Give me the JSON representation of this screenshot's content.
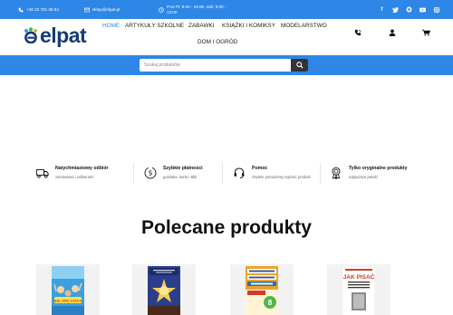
{
  "topbar": {
    "phone": "+48 22 781 36 84",
    "email": "sklep@elpat.pl",
    "hours": "Pon-Pt: 8:30 - 16:00, sob: 9:00 - 13:00",
    "social": [
      "facebook-icon",
      "twitter-icon",
      "google-icon",
      "youtube-icon",
      "instagram-icon"
    ],
    "color": "#2e86e6"
  },
  "logo": {
    "text": "elpat",
    "color": "#163a74"
  },
  "nav": {
    "items": [
      {
        "label": "HOME",
        "active": true
      },
      {
        "label": "ARTYKUŁY SZKOLNE",
        "active": false
      },
      {
        "label": "ZABAWKI",
        "active": false
      },
      {
        "label": "KSIĄŻKI I KOMIKSY",
        "active": false
      },
      {
        "label": "MODELARSTWO",
        "active": false
      },
      {
        "label": "DOM I OGRÓD",
        "active": false
      }
    ],
    "accent": "#2e86e6"
  },
  "header_icons": {
    "phone": "phone-icon",
    "user": "user-icon",
    "cart": "cart-icon"
  },
  "search": {
    "placeholder": "Szukaj produktów",
    "button": "search-icon"
  },
  "features": [
    {
      "title": "Natychmiastowy odbiór",
      "subtitle": "zamawiasz i odbierasz",
      "icon": "truck-icon"
    },
    {
      "title": "Szybkie płatności",
      "subtitle": "gotówka, karta i Blik",
      "icon": "dollar-icon"
    },
    {
      "title": "Pomoc",
      "subtitle": "chętnie pomożemy wybrać produkt",
      "icon": "headset-icon"
    },
    {
      "title": "Tylko oryginalne produkty",
      "subtitle": "najwyższa jakość",
      "icon": "award-icon"
    }
  ],
  "section": {
    "title": "Polecane produkty"
  },
  "products": [
    {
      "cover_title": "BĄL WAS SZAKA",
      "cover_color": "#3ba0e0"
    },
    {
      "cover_title": "",
      "cover_color": "#2a3e8c"
    },
    {
      "cover_title": "EGZAMIN ÓSMOKLASISTY REPETYTORIUM MATEMATYKA",
      "cover_color": "#e9a530"
    },
    {
      "cover_title": "JAK PISAĆ rozprawkę, opowiadanie, charakterystykę...",
      "cover_color": "#ffffff"
    }
  ]
}
